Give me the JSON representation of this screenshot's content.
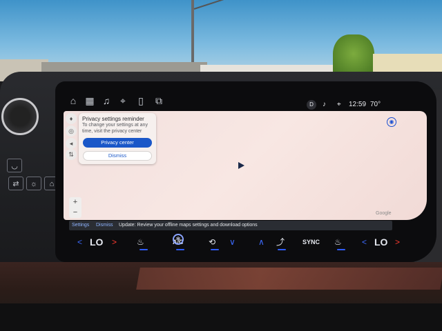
{
  "topbar": {
    "icons": [
      "home-icon",
      "apps-icon",
      "music-icon",
      "navigation-pin-icon",
      "phone-icon",
      "vehicle-controls-icon"
    ]
  },
  "status": {
    "user_initial": "D",
    "time": "12:59",
    "temperature": "70°"
  },
  "privacy_card": {
    "title": "Privacy settings reminder",
    "body": "To change your settings at any time, visit the privacy center",
    "primary_button": "Privacy center",
    "secondary_button": "Dismiss"
  },
  "map": {
    "attribution": "Google",
    "zoom_in": "+",
    "zoom_out": "−"
  },
  "notification": {
    "settings_link": "Settings",
    "dismiss_link": "Dismiss",
    "message": "Update: Review your offline maps settings and download options"
  },
  "climate": {
    "left_temp": "LO",
    "right_temp": "LO",
    "ac_label": "A/C",
    "sync_label": "SYNC"
  }
}
